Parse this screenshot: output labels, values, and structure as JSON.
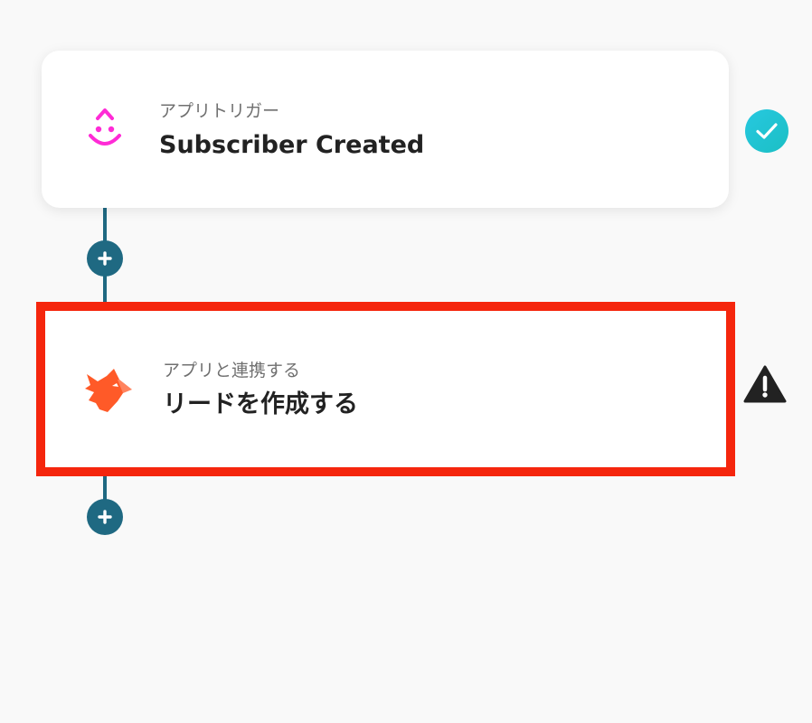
{
  "flow": {
    "steps": [
      {
        "label": "アプリトリガー",
        "title": "Subscriber Created",
        "app_icon": "droplet-face-icon",
        "status": "check-icon"
      },
      {
        "label": "アプリと連携する",
        "title": "リードを作成する",
        "app_icon": "fox-icon",
        "status": "warning-icon"
      }
    ]
  },
  "colors": {
    "background": "#f9f9f9",
    "connector": "#1f6982",
    "highlight_border": "#f5260d",
    "check_badge": "#20c4d6",
    "trigger_icon": "#ff2bd6",
    "action_icon": "#ff5a28",
    "warning": "#222222"
  }
}
